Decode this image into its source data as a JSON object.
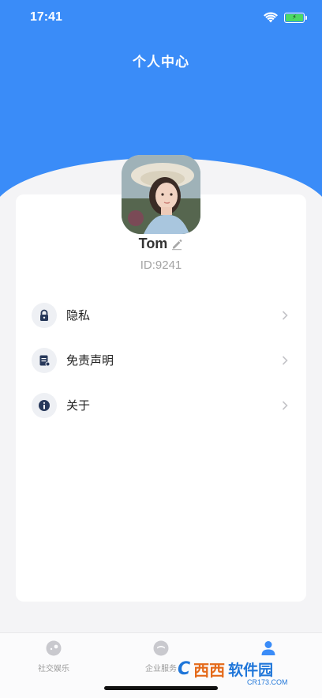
{
  "status_bar": {
    "time": "17:41"
  },
  "header": {
    "title": "个人中心"
  },
  "profile": {
    "username": "Tom",
    "user_id": "ID:9241"
  },
  "menu": [
    {
      "label": "隐私",
      "icon": "lock-icon"
    },
    {
      "label": "免责声明",
      "icon": "document-icon"
    },
    {
      "label": "关于",
      "icon": "info-icon"
    }
  ],
  "tabbar": [
    {
      "label": "社交娱乐",
      "icon": "chat-icon",
      "active": false
    },
    {
      "label": "企业服务",
      "icon": "service-icon",
      "active": false
    },
    {
      "label": "",
      "icon": "person-icon",
      "active": true
    }
  ],
  "watermark": {
    "mark": "C",
    "text": "西西",
    "name": "软件园",
    "domain": "CR173.COM"
  },
  "colors": {
    "primary": "#3a8cf8",
    "background": "#f4f4f6",
    "icon_dark": "#27385a"
  }
}
